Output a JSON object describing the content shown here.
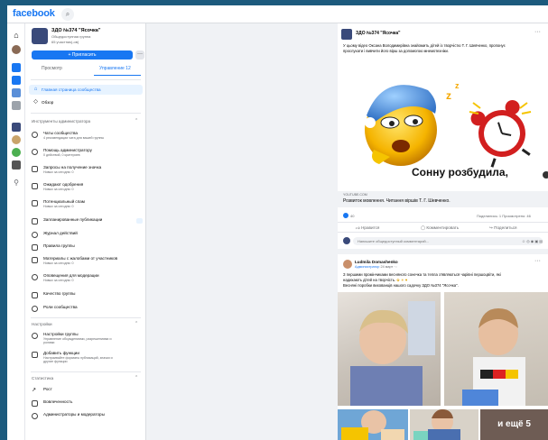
{
  "app": {
    "brand": "facebook",
    "brand_color": "#1877f2"
  },
  "group": {
    "name": "ЗДО №374 \"Ясочка\"",
    "type": "Общедоступная группа",
    "members": "65 участник(-ов)",
    "invite_label": "+ Пригласить",
    "more_label": "···"
  },
  "tabs": [
    {
      "label": "Просмотр",
      "active": false
    },
    {
      "label": "Управление 12",
      "active": true
    }
  ],
  "nav": {
    "home": "Главная страница сообщества",
    "overview": "Обзор"
  },
  "admin_tools": {
    "header": "Инструменты администратора",
    "items": [
      {
        "title": "Чаты сообщества",
        "sub": "4 рекомендации чата для вашей группы"
      },
      {
        "title": "Помощь администратору",
        "sub": "0 действий, 0 критериев"
      },
      {
        "title": "Запросы на получение значка",
        "sub": "Новых за сегодня: 0"
      },
      {
        "title": "Ожидают одобрения",
        "sub": "Новых за сегодня: 0"
      },
      {
        "title": "Потенциальный спам",
        "sub": "Новых за сегодня: 0"
      },
      {
        "title": "Запланированные публикации",
        "sub": ""
      },
      {
        "title": "Журнал действий",
        "sub": ""
      },
      {
        "title": "Правила группы",
        "sub": ""
      },
      {
        "title": "Материалы с жалобами от участников",
        "sub": "Новых за сегодня: 0"
      },
      {
        "title": "Оповещения для модерации",
        "sub": "Новых за сегодня: 0"
      },
      {
        "title": "Качество группы",
        "sub": ""
      },
      {
        "title": "Роли сообщества",
        "sub": ""
      }
    ]
  },
  "settings": {
    "header": "Настройки",
    "items": [
      {
        "title": "Настройки группы",
        "sub": "Управление обсуждениями, разрешениями и",
        "sub2": "ролями"
      },
      {
        "title": "Добавить функции",
        "sub": "Настраивайте форматы публикаций, значки и",
        "sub2": "другие функции"
      }
    ]
  },
  "stats": {
    "header": "Статистика",
    "items": [
      "Рост",
      "Вовлеченность",
      "Администраторы и модераторы"
    ]
  },
  "post1": {
    "author": "ЗДО №374 \"Ясочка\"",
    "text_line1": "У цьому відео Оксана Володимирівна знайомить дітей із творчістю Т. Г. Шевченко, пропонує",
    "text_line2": "прослухати і вивчити його вірш за допомогою мнемотехніки.",
    "image_caption": "Сонну розбудила,",
    "link_source": "YOUTUBE.COM",
    "link_title": "Розвиток мовлення. Читання віршів Т. Г. Шевченко.",
    "reactions": "40",
    "shares_views": "Поделились: 1   Просмотрено: 46",
    "actions": {
      "like": "Нравится",
      "comment": "Комментировать",
      "share": "Поделиться"
    },
    "comment_placeholder": "Напишите общедоступный комментарий...",
    "comment_icons": "☺ ◎ ◉ ▣ ▤"
  },
  "post2": {
    "author": "Ludmila Domashenko",
    "role": "Администратор",
    "time": "24 март",
    "text_line1": "З першими промінчиками весняного сонечка та тепла з'являються чарівні першоцвіти, які",
    "text_line2": "надихають дітей на творчість.",
    "text_line3": "Весняні поробки вихованців нашого садочку ЗДО №374 \"Ясочка\".",
    "more_photos": "и ещё 5"
  }
}
